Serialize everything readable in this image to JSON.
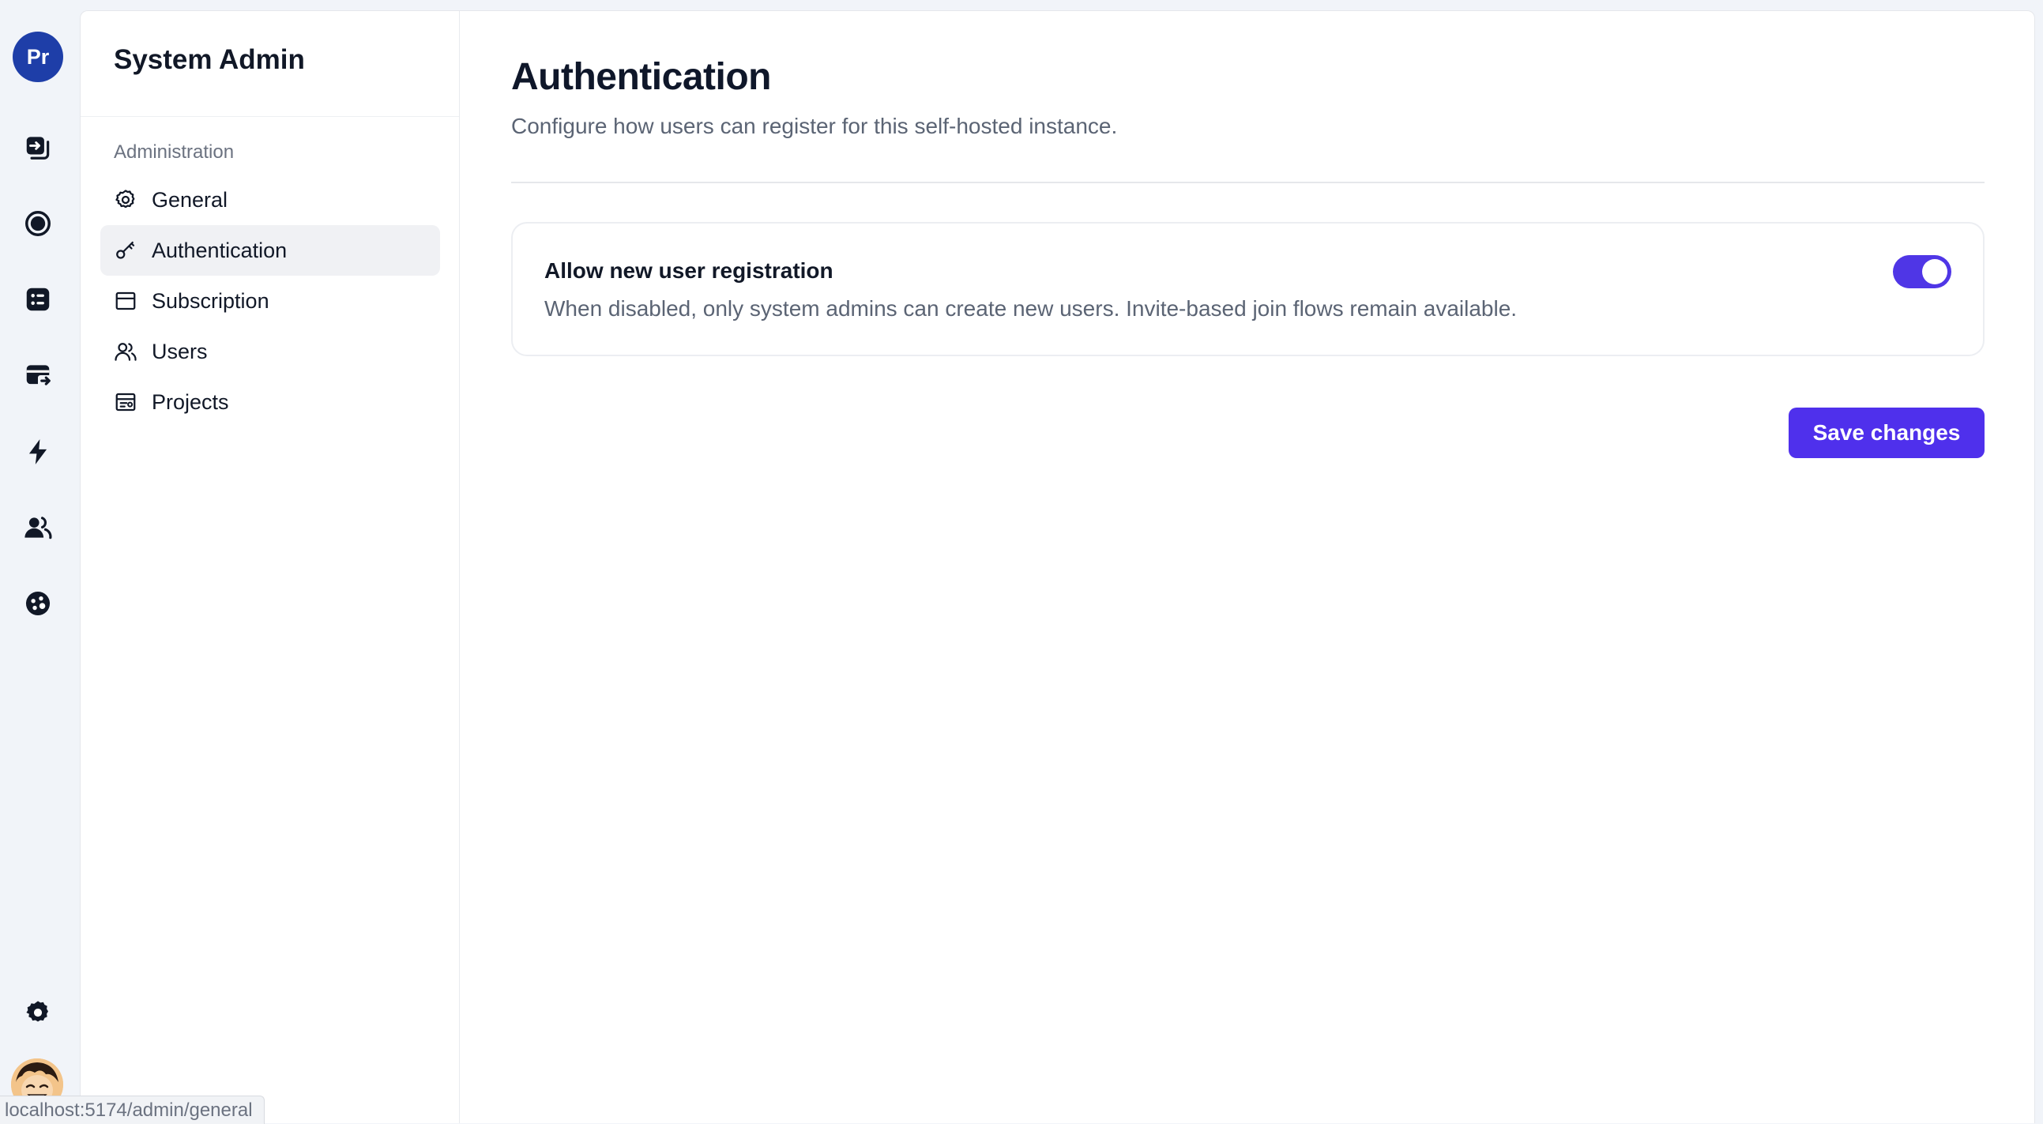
{
  "rail": {
    "workspace_initials": "Pr",
    "items": [
      {
        "icon": "sign-in-icon"
      },
      {
        "icon": "record-icon"
      },
      {
        "icon": "list-icon"
      },
      {
        "icon": "card-exit-icon"
      },
      {
        "icon": "bolt-icon"
      },
      {
        "icon": "users-icon"
      },
      {
        "icon": "palette-icon"
      }
    ],
    "settings_icon": "gear-icon",
    "user_avatar": "user-avatar"
  },
  "admin_nav": {
    "title": "System Admin",
    "section_label": "Administration",
    "items": [
      {
        "label": "General",
        "icon": "gear-outline-icon",
        "active": false
      },
      {
        "label": "Authentication",
        "icon": "key-icon",
        "active": true
      },
      {
        "label": "Subscription",
        "icon": "card-icon",
        "active": false
      },
      {
        "label": "Users",
        "icon": "users-outline-icon",
        "active": false
      },
      {
        "label": "Projects",
        "icon": "projects-icon",
        "active": false
      }
    ]
  },
  "main": {
    "title": "Authentication",
    "subtitle": "Configure how users can register for this self-hosted instance.",
    "setting": {
      "title": "Allow new user registration",
      "description": "When disabled, only system admins can create new users. Invite-based join flows remain available.",
      "enabled": true
    },
    "save_label": "Save changes"
  },
  "status_url": "localhost:5174/admin/general",
  "colors": {
    "accent": "#4f30ec",
    "toggle_on": "#4f36e6",
    "workspace_avatar": "#1e3ea8"
  }
}
